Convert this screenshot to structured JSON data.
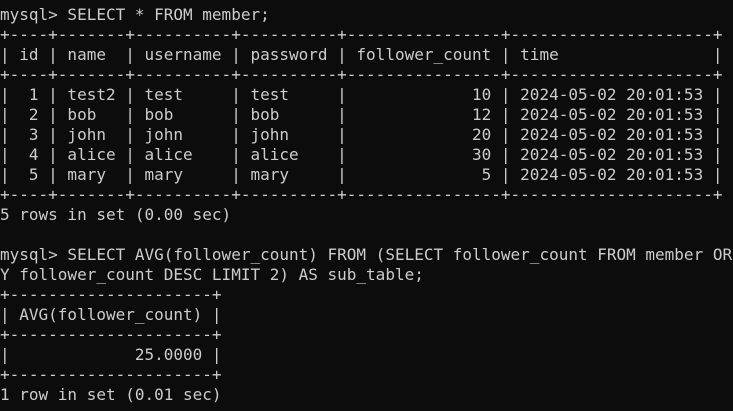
{
  "terminal": {
    "lines": [
      "mysql> SELECT * FROM member;",
      "+----+-------+----------+----------+----------------+---------------------+",
      "| id | name  | username | password | follower_count | time                |",
      "+----+-------+----------+----------+----------------+---------------------+",
      "|  1 | test2 | test     | test     |             10 | 2024-05-02 20:01:53 |",
      "|  2 | bob   | bob      | bob      |             12 | 2024-05-02 20:01:53 |",
      "|  3 | john  | john     | john     |             20 | 2024-05-02 20:01:53 |",
      "|  4 | alice | alice    | alice    |             30 | 2024-05-02 20:01:53 |",
      "|  5 | mary  | mary     | mary     |              5 | 2024-05-02 20:01:53 |",
      "+----+-------+----------+----------+----------------+---------------------+",
      "5 rows in set (0.00 sec)",
      "",
      "mysql> SELECT AVG(follower_count) FROM (SELECT follower_count FROM member ORDER B",
      "Y follower_count DESC LIMIT 2) AS sub_table;",
      "+---------------------+",
      "| AVG(follower_count) |",
      "+---------------------+",
      "|             25.0000 |",
      "+---------------------+",
      "1 row in set (0.01 sec)"
    ]
  },
  "colors": {
    "background": "#0c0c0c",
    "text": "#cccccc"
  }
}
